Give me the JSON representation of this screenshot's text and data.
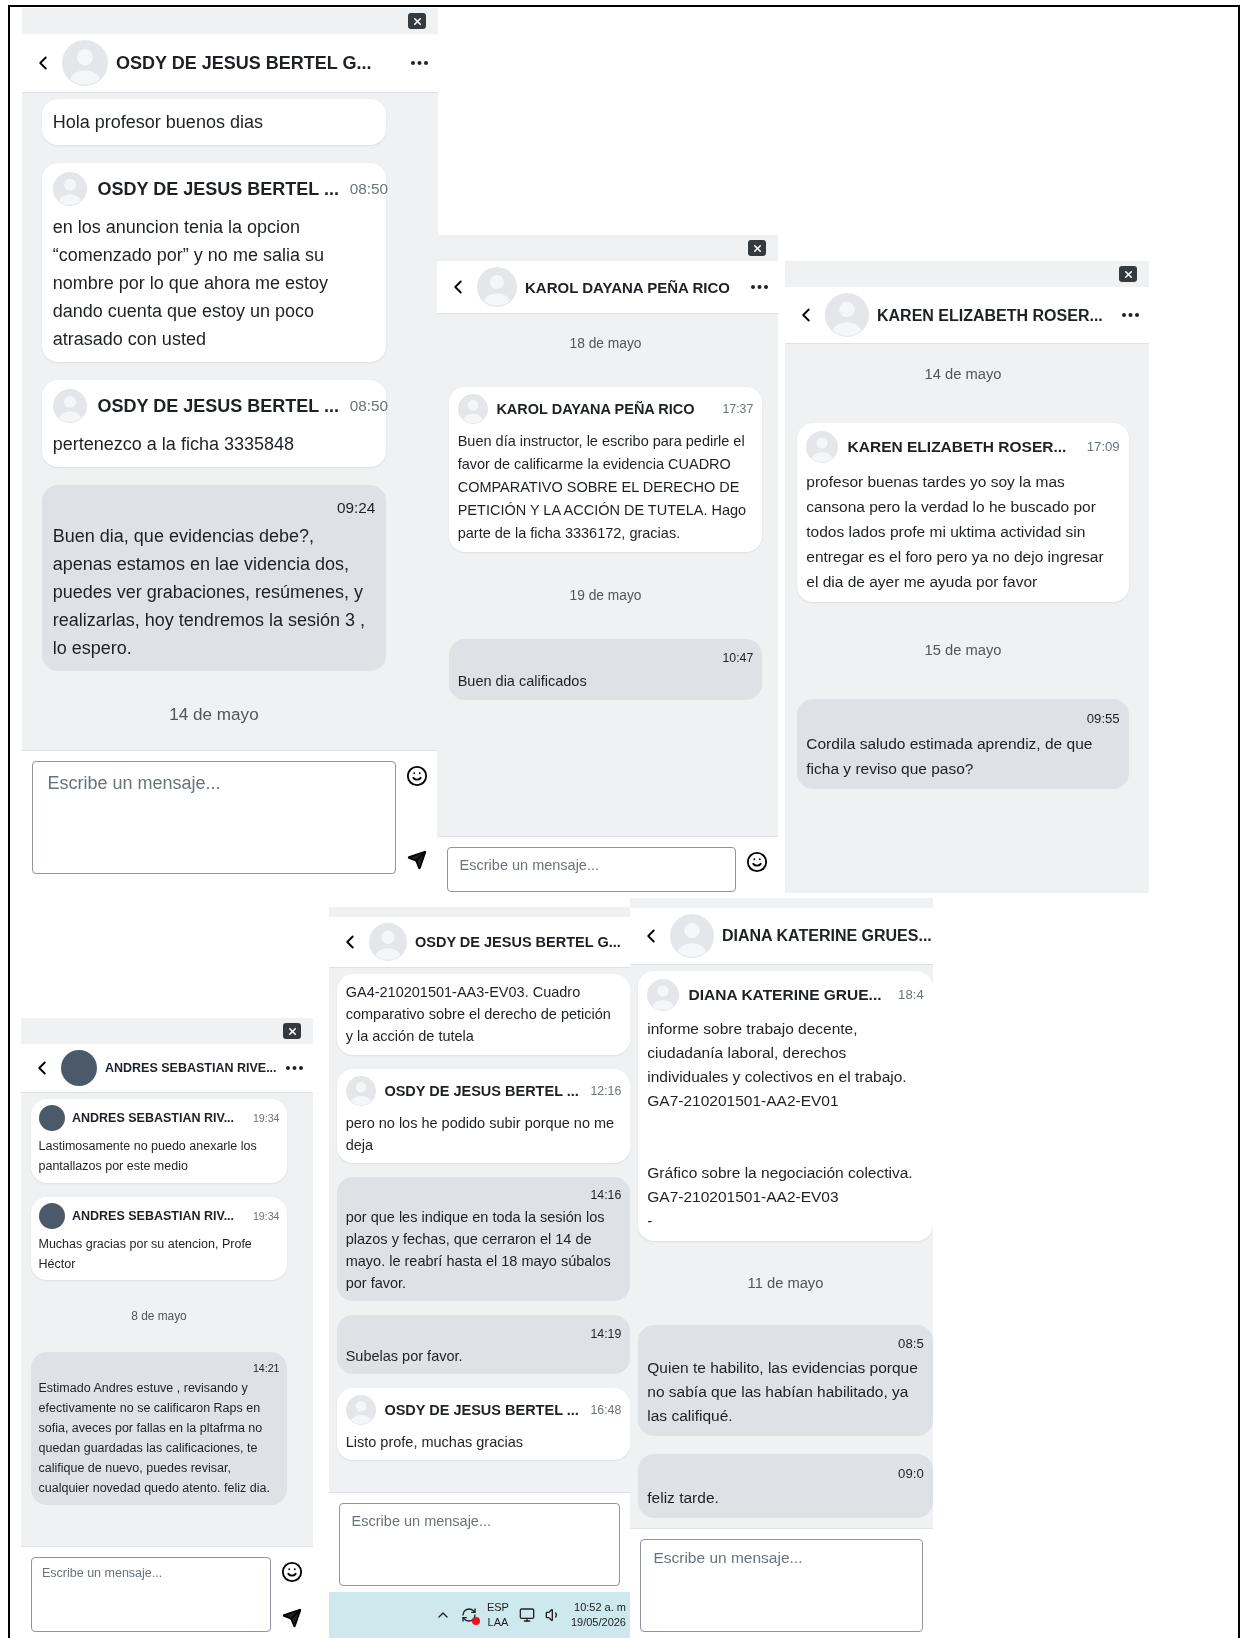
{
  "panels": [
    {
      "kind": "default-avatar",
      "close": true,
      "header": {
        "title": "OSDY DE JESUS BERTEL G...",
        "menu": true
      },
      "messages": [
        {
          "kind": "incoming",
          "text": "Hola profesor buenos dias"
        },
        {
          "kind": "incoming",
          "sender": "OSDY DE JESUS BERTEL ...",
          "time": "08:50",
          "text": "en los anuncion tenia la opcion “comenzado por” y no me salia su nombre por lo que ahora me estoy dando cuenta que estoy un poco atrasado con usted"
        },
        {
          "kind": "incoming",
          "sender": "OSDY DE JESUS BERTEL ...",
          "time": "08:50",
          "text": "pertenezco a la ficha 3335848"
        },
        {
          "kind": "outgoing",
          "time": "09:24",
          "text": "Buen dia, que evidencias debe?, apenas estamos en lae videncia dos, puedes ver grabaciones, resúmenes, y realizarlas, hoy tendremos la sesión 3 , lo espero."
        },
        {
          "kind": "date",
          "text": "14 de mayo"
        }
      ],
      "composer": {
        "placeholder": "Escribe un mensaje...",
        "emoji": true,
        "send": true
      }
    },
    {
      "kind": "default-avatar",
      "close": true,
      "header": {
        "title": "KAROL DAYANA PEÑA RICO",
        "menu": true
      },
      "messages": [
        {
          "kind": "date",
          "text": "18 de mayo"
        },
        {
          "kind": "incoming",
          "sender": "KAROL DAYANA PEÑA RICO",
          "time": "17:37",
          "text": "Buen día instructor, le escribo para pedirle el favor de calificarme la evidencia CUADRO COMPARATIVO SOBRE EL DERECHO DE PETICIÓN Y LA ACCIÓN DE TUTELA. Hago parte de la ficha 3336172, gracias."
        },
        {
          "kind": "date",
          "text": "19 de mayo"
        },
        {
          "kind": "outgoing",
          "time": "10:47",
          "text": "Buen dia calificados"
        }
      ],
      "composer": {
        "placeholder": "Escribe un mensaje...",
        "emoji": true,
        "send": false
      }
    },
    {
      "kind": "default-avatar",
      "close": true,
      "header": {
        "title": "KAREN ELIZABETH ROSER...",
        "menu": true
      },
      "messages": [
        {
          "kind": "date",
          "text": "14 de mayo"
        },
        {
          "kind": "incoming",
          "sender": "KAREN ELIZABETH ROSER...",
          "time": "17:09",
          "text": "profesor buenas tardes yo soy la mas cansona pero la verdad lo he buscado por todos lados profe mi uktima actividad sin entregar es el foro pero ya no dejo ingresar el dia de ayer me ayuda por favor"
        },
        {
          "kind": "date",
          "text": "15 de mayo"
        },
        {
          "kind": "outgoing",
          "time": "09:55",
          "text": "Cordila saludo estimada aprendiz, de que ficha y reviso que paso?"
        }
      ]
    },
    {
      "kind": "photo-avatar",
      "close": true,
      "header": {
        "title": "ANDRES SEBASTIAN RIVE...",
        "menu": true
      },
      "messages": [
        {
          "kind": "incoming",
          "sender": "ANDRES SEBASTIAN RIV...",
          "time": "19:34",
          "text": "Lastimosamente no puedo anexarle los pantallazos por este medio"
        },
        {
          "kind": "incoming",
          "sender": "ANDRES SEBASTIAN RIV...",
          "time": "19:34",
          "text": "Muchas gracias por su atencion, Profe Héctor"
        },
        {
          "kind": "date",
          "text": "8 de mayo"
        },
        {
          "kind": "outgoing",
          "time": "14:21",
          "text": "Estimado Andres estuve , revisando y efectivamente no se calificaron Raps en sofia, aveces por fallas en la pltafrma no quedan guardadas las calificaciones, te califique de nuevo, puedes revisar, cualquier novedad quedo atento. feliz dia."
        }
      ],
      "composer": {
        "placeholder": "Escribe un mensaje...",
        "emoji": true,
        "send": true
      }
    },
    {
      "kind": "default-avatar",
      "close": false,
      "header": {
        "title": "OSDY DE JESUS BERTEL G...",
        "menu": false
      },
      "messages": [
        {
          "kind": "incoming",
          "text": "GA4-210201501-AA3-EV03. Cuadro comparativo sobre el derecho de petición y la acción de tutela"
        },
        {
          "kind": "incoming",
          "sender": "OSDY DE JESUS BERTEL ...",
          "time": "12:16",
          "text": "pero no los he podido subir porque no me deja"
        },
        {
          "kind": "outgoing",
          "time": "14:16",
          "text": "por que les indique en toda la sesión los plazos y fechas, que cerraron el 14 de mayo. le reabrí hasta el 18 mayo súbalos por favor."
        },
        {
          "kind": "outgoing",
          "time": "14:19",
          "text": "Subelas por favor."
        },
        {
          "kind": "incoming",
          "sender": "OSDY DE JESUS BERTEL ...",
          "time": "16:48",
          "text": "Listo profe, muchas gracias"
        }
      ],
      "composer": {
        "placeholder": "Escribe un mensaje...",
        "emoji": false,
        "send": false
      },
      "taskbar": {
        "language": "ESP",
        "layout": "LAA",
        "time": "10:52 a. m",
        "date": "19/05/2026"
      }
    },
    {
      "kind": "default-avatar",
      "close": false,
      "header": {
        "title": "DIANA KATERINE GRUES...",
        "menu": false
      },
      "messages": [
        {
          "kind": "incoming",
          "sender": "DIANA KATERINE GRUE...",
          "time": "18:4",
          "text": "informe sobre trabajo decente, ciudadanía laboral, derechos individuales y colectivos en el trabajo.\nGA7-210201501-AA2-EV01\n\n\nGráfico sobre la negociación colectiva.\nGA7-210201501-AA2-EV03\n-"
        },
        {
          "kind": "date",
          "text": "11 de mayo"
        },
        {
          "kind": "outgoing",
          "time": "08:5",
          "text": "Quien te habilito, las evidencias porque no sabía que las habían habilitado, ya las califiqué."
        },
        {
          "kind": "outgoing",
          "time": "09:0",
          "text": "feliz tarde."
        }
      ],
      "composer": {
        "placeholder": "Escribe un mensaje...",
        "emoji": false,
        "send": false
      }
    }
  ]
}
